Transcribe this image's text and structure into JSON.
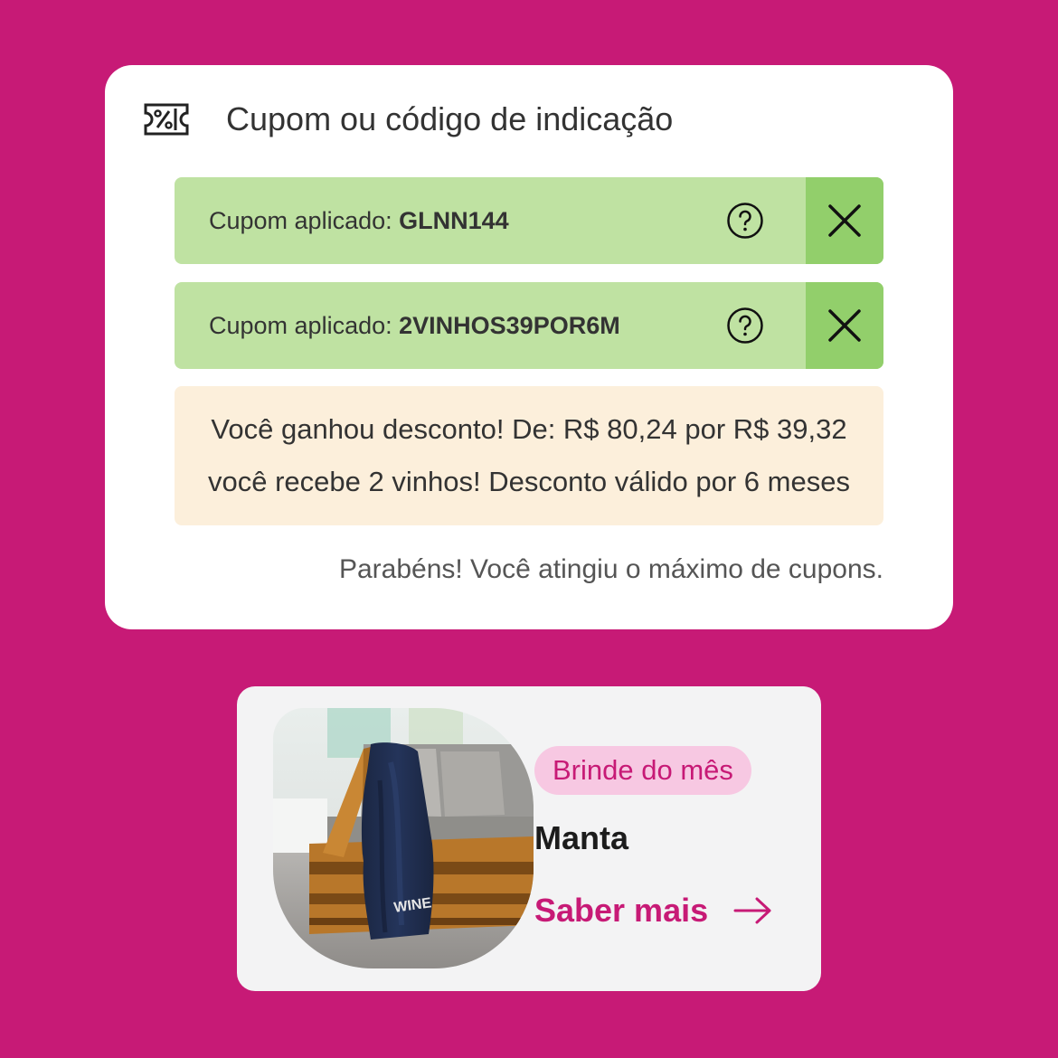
{
  "coupon_section": {
    "title": "Cupom ou código de indicação",
    "icon": "coupon-percent-icon"
  },
  "applied_coupons": [
    {
      "prefix": "Cupom aplicado: ",
      "code": "GLNN144"
    },
    {
      "prefix": "Cupom aplicado: ",
      "code": "2VINHOS39POR6M"
    }
  ],
  "discount_message": {
    "line1": "Você ganhou desconto! De: R$ 80,24 por R$ 39,32",
    "line2": "você recebe 2 vinhos! Desconto válido por 6 meses"
  },
  "max_coupons_message": "Parabéns! Você atingiu o máximo de cupons.",
  "gift": {
    "badge": "Brinde do mês",
    "name": "Manta",
    "link_label": "Saber mais",
    "blanket_print": "WINE"
  },
  "colors": {
    "background": "#c71a76",
    "chip_green": "#bfe2a2",
    "chip_remove_green": "#92cf6b",
    "discount_bg": "#fcefdb",
    "brand_pink": "#c71a76",
    "badge_pink": "#f7c8e2"
  }
}
